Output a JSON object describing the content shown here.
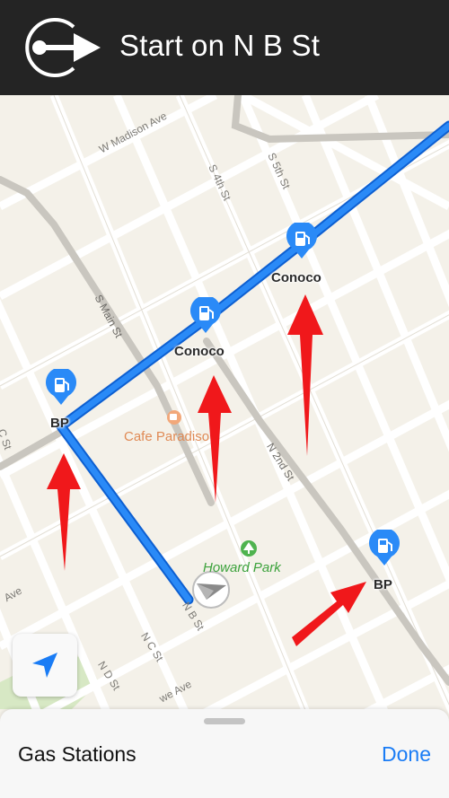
{
  "nav_banner": {
    "instruction": "Start on N B St",
    "maneuver_icon": "start-route-arrow-icon"
  },
  "map": {
    "route_color": "#1a7cf5",
    "streets": {
      "w_madison_ave": "W Madison Ave",
      "s_4th_st": "S 4th St",
      "s_5th_st": "S 5th St",
      "s_main_st": "S Main St",
      "c_st": "C St",
      "n_2nd_st": "N 2nd St",
      "n_b_st": "N B St",
      "n_c_st": "N C St",
      "n_d_st": "N D St",
      "ave_left": "Ave",
      "we_ave": "we Ave"
    },
    "gas_stations": [
      {
        "name": "BP",
        "icon": "fuel-pump-icon"
      },
      {
        "name": "Conoco",
        "icon": "fuel-pump-icon"
      },
      {
        "name": "Conoco",
        "icon": "fuel-pump-icon"
      },
      {
        "name": "BP",
        "icon": "fuel-pump-icon"
      }
    ],
    "places": {
      "cafe": "Cafe Paradiso",
      "park": "Howard Park"
    },
    "annotation_color": "#f0181b"
  },
  "sheet": {
    "title": "Gas Stations",
    "done_label": "Done"
  }
}
